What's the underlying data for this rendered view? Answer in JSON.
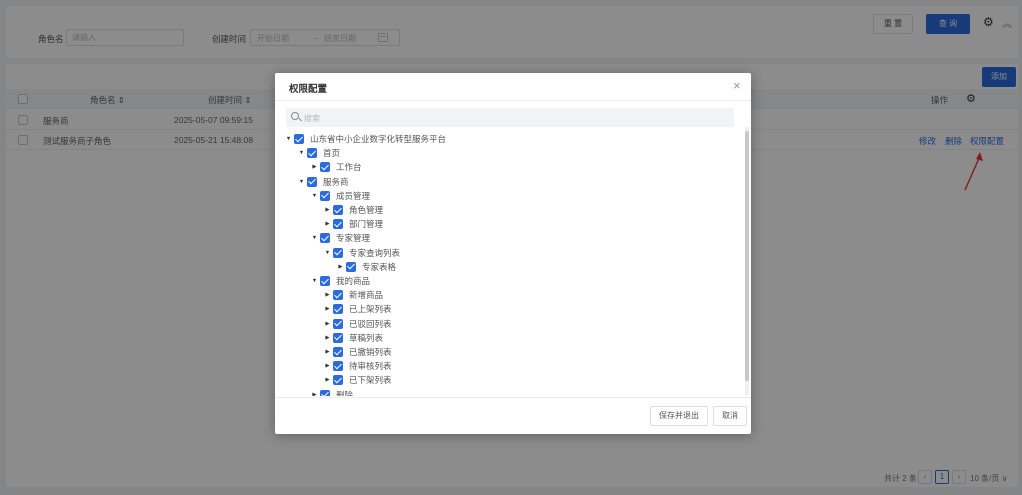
{
  "filters": {
    "role_name_label": "角色名",
    "role_name_placeholder": "请输入",
    "created_time_label": "创建时间",
    "start_date_placeholder": "开始日期",
    "range_separator": "→",
    "end_date_placeholder": "结束日期"
  },
  "toolbar": {
    "reset_label": "重 置",
    "query_label": "查 询"
  },
  "table": {
    "add_label": "添加",
    "columns": [
      "角色名 ⇕",
      "创建时间 ⇕",
      "操作"
    ],
    "rows": [
      {
        "name": "服务商",
        "created": "2025-05-07 09:59:15",
        "actions": []
      },
      {
        "name": "测试服务商子角色",
        "created": "2025-05-21 15:48:08",
        "actions": [
          "修改",
          "删除",
          "权限配置"
        ]
      }
    ]
  },
  "pagination": {
    "total": "共计 2 条",
    "current_page": "1",
    "page_size": "10 条/页 ∨"
  },
  "modal": {
    "title": "权限配置",
    "search_placeholder": "搜索",
    "tree": [
      {
        "label": "山东省中小企业数字化转型服务平台",
        "level": 0,
        "expanded": true
      },
      {
        "label": "首页",
        "level": 1,
        "expanded": true
      },
      {
        "label": "工作台",
        "level": 2,
        "expanded": false
      },
      {
        "label": "服务商",
        "level": 1,
        "expanded": true
      },
      {
        "label": "成员管理",
        "level": 2,
        "expanded": true
      },
      {
        "label": "角色管理",
        "level": 3,
        "expanded": false
      },
      {
        "label": "部门管理",
        "level": 3,
        "expanded": false
      },
      {
        "label": "专家管理",
        "level": 2,
        "expanded": true
      },
      {
        "label": "专家查询列表",
        "level": 3,
        "expanded": true
      },
      {
        "label": "专家表格",
        "level": 4,
        "expanded": false
      },
      {
        "label": "我的商品",
        "level": 2,
        "expanded": true
      },
      {
        "label": "新增商品",
        "level": 3,
        "expanded": false
      },
      {
        "label": "已上架列表",
        "level": 3,
        "expanded": false
      },
      {
        "label": "已驳回列表",
        "level": 3,
        "expanded": false
      },
      {
        "label": "草稿列表",
        "level": 3,
        "expanded": false
      },
      {
        "label": "已撤销列表",
        "level": 3,
        "expanded": false
      },
      {
        "label": "待审核列表",
        "level": 3,
        "expanded": false
      },
      {
        "label": "已下架列表",
        "level": 3,
        "expanded": false
      },
      {
        "label": "删除",
        "level": 2,
        "expanded": false
      }
    ],
    "save_label": "保存并退出",
    "cancel_label": "取消"
  },
  "colors": {
    "primary": "#2a6be0",
    "annotation_arrow": "#e53935"
  }
}
